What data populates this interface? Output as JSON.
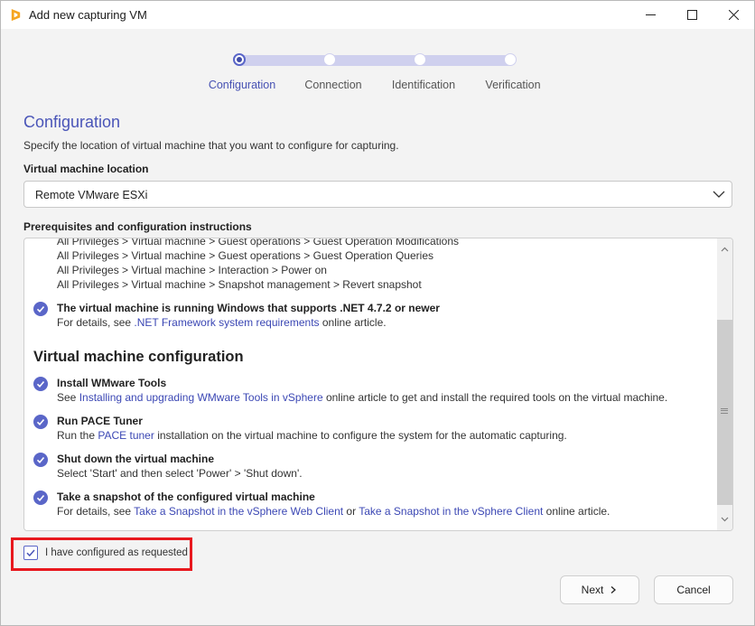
{
  "window": {
    "title": "Add new capturing VM"
  },
  "stepper": {
    "steps": [
      {
        "label": "Configuration",
        "active": true
      },
      {
        "label": "Connection",
        "active": false
      },
      {
        "label": "Identification",
        "active": false
      },
      {
        "label": "Verification",
        "active": false
      }
    ]
  },
  "page": {
    "heading": "Configuration",
    "subtitle": "Specify the location of virtual machine that you want to configure for capturing."
  },
  "vm_location": {
    "label": "Virtual machine location",
    "value": "Remote VMware ESXi"
  },
  "prereq": {
    "label": "Prerequisites and configuration instructions",
    "privileges": [
      "All Privileges > Virtual machine > Guest operations > Guest Operation Modifications",
      "All Privileges > Virtual machine > Guest operations > Guest Operation Queries",
      "All Privileges > Virtual machine > Interaction > Power on",
      "All Privileges > Virtual machine > Snapshot management > Revert snapshot"
    ],
    "dotnet": {
      "title": "The virtual machine is running Windows that supports .NET 4.7.2 or newer",
      "pre": "For details, see ",
      "link": ".NET Framework system requirements",
      "post": " online article."
    },
    "section_title": "Virtual machine configuration",
    "items": [
      {
        "title": "Install WMware Tools",
        "pre": "See ",
        "link": "Installing and upgrading WMware Tools in vSphere",
        "post": " online article to get and install the required tools on the virtual machine."
      },
      {
        "title": "Run PACE Tuner",
        "pre": "Run the ",
        "link": "PACE tuner",
        "post": " installation on the virtual machine to configure the system for the automatic capturing."
      },
      {
        "title": "Shut down the virtual machine",
        "text": "Select 'Start' and then select 'Power' > 'Shut down'."
      },
      {
        "title": "Take a snapshot of the configured virtual machine",
        "pre": "For details, see ",
        "link": "Take a Snapshot in the vSphere Web Client",
        "mid": " or ",
        "link2": "Take a Snapshot in the vSphere Client",
        "post": " online article."
      }
    ]
  },
  "confirm": {
    "label": "I have configured as requested",
    "checked": true
  },
  "buttons": {
    "next": "Next",
    "cancel": "Cancel"
  },
  "colors": {
    "accent": "#4a55b8",
    "highlight": "#e8181e"
  }
}
